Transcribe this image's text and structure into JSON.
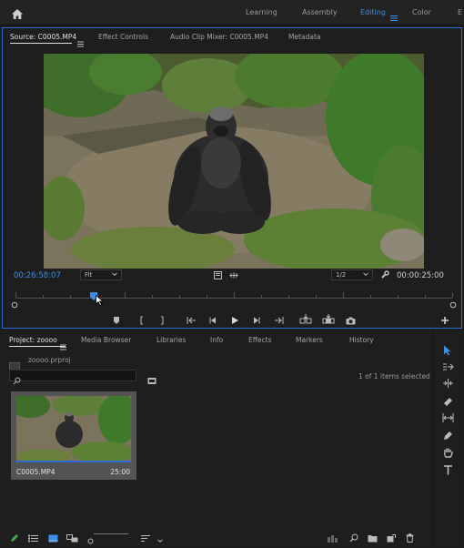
{
  "topbar": {
    "workspaces": [
      "Learning",
      "Assembly",
      "Editing",
      "Color",
      "E"
    ],
    "active_workspace": "Editing"
  },
  "source_panel": {
    "tabs": [
      "Source: C0005.MP4",
      "Effect Controls",
      "Audio Clip Mixer: C0005.MP4",
      "Metadata"
    ],
    "playhead_time": "00:26:58:07",
    "zoom": "Fit",
    "resolution": "1/2",
    "duration": "00:00:25:00",
    "playhead_position": 0.18
  },
  "project_panel": {
    "tabs": [
      "Project: zoooo",
      "Media Browser",
      "Libraries",
      "Info",
      "Effects",
      "Markers",
      "History"
    ],
    "project_file": "zoooo.prproj",
    "search_placeholder": "",
    "selection_status": "1 of 1 items selected",
    "item": {
      "name": "C0005.MP4",
      "duration": "25:00"
    }
  },
  "colors": {
    "accent": "#3d8ee8",
    "panel_border": "#2c6bd1",
    "background": "#1d1d1d"
  },
  "icons": {
    "home": "home-icon",
    "menu": "hamburger-icon",
    "tools": [
      "selection-tool-icon",
      "track-select-forward-icon",
      "ripple-edit-icon",
      "razor-icon",
      "slip-icon",
      "pen-icon",
      "hand-icon",
      "type-icon"
    ]
  }
}
